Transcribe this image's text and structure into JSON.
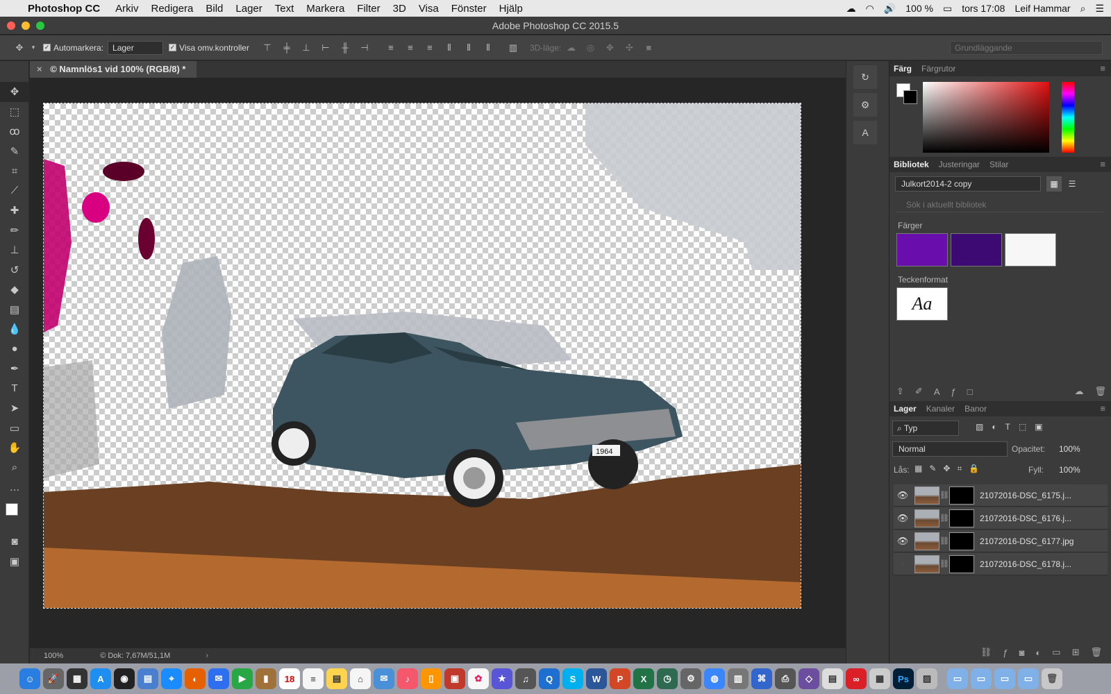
{
  "menubar": {
    "app": "Photoshop CC",
    "items": [
      "Arkiv",
      "Redigera",
      "Bild",
      "Lager",
      "Text",
      "Markera",
      "Filter",
      "3D",
      "Visa",
      "Fönster",
      "Hjälp"
    ],
    "battery": "100 %",
    "clock": "tors 17:08",
    "user": "Leif Hammar"
  },
  "window": {
    "title": "Adobe Photoshop CC 2015.5"
  },
  "options": {
    "auto_select_label": "Automarkera:",
    "auto_select_value": "Lager",
    "show_transform_label": "Visa omv.kontroller",
    "mode3d_label": "3D-läge:",
    "workspace": "Grundläggande"
  },
  "document": {
    "tab_title": "© Namnlös1 vid 100% (RGB/8) *",
    "zoom": "100%",
    "doc_info": "© Dok: 7,67M/51,1M",
    "plate_text": "1964"
  },
  "color_panel": {
    "tabs": [
      "Färg",
      "Färgrutor"
    ]
  },
  "library_panel": {
    "tabs": [
      "Bibliotek",
      "Justeringar",
      "Stilar"
    ],
    "library": "Julkort2014-2 copy",
    "search_placeholder": "Sök i aktuellt bibliotek",
    "colors_heading": "Färger",
    "swatches": [
      "#6a0dad",
      "#3d0a74",
      "#f7f7f7"
    ],
    "charstyles_heading": "Teckenformat",
    "charstyle_sample": "Aa"
  },
  "layers_panel": {
    "tabs": [
      "Lager",
      "Kanaler",
      "Banor"
    ],
    "filter": "Typ",
    "blend_mode": "Normal",
    "opacity_label": "Opacitet:",
    "opacity": "100%",
    "lock_label": "Lås:",
    "fill_label": "Fyll:",
    "fill": "100%",
    "layers": [
      {
        "name": "21072016-DSC_6175.j...",
        "visible": true
      },
      {
        "name": "21072016-DSC_6176.j...",
        "visible": true
      },
      {
        "name": "21072016-DSC_6177.jpg",
        "visible": true
      },
      {
        "name": "21072016-DSC_6178.j...",
        "visible": false
      }
    ]
  },
  "icons": {
    "tools": [
      "move-icon",
      "marquee-icon",
      "lasso-icon",
      "quick-select-icon",
      "crop-icon",
      "eyedropper-icon",
      "healing-icon",
      "brush-icon",
      "stamp-icon",
      "history-brush-icon",
      "eraser-icon",
      "gradient-icon",
      "blur-icon",
      "dodge-icon",
      "pen-icon",
      "type-icon",
      "path-select-icon",
      "rectangle-icon",
      "hand-icon",
      "zoom-icon",
      "more-icon"
    ]
  }
}
